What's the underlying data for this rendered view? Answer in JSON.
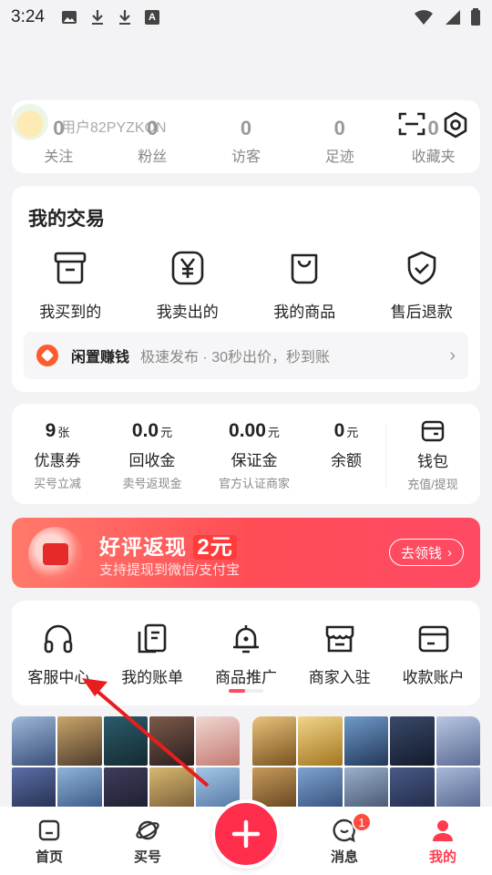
{
  "status_bar": {
    "time": "3:24",
    "a_icon": "A"
  },
  "profile": {
    "username": "用户82PYZKON",
    "stats": [
      {
        "value": "0",
        "label": "关注"
      },
      {
        "value": "0",
        "label": "粉丝"
      },
      {
        "value": "0",
        "label": "访客"
      },
      {
        "value": "0",
        "label": "足迹"
      },
      {
        "value": "0",
        "label": "收藏夹"
      }
    ]
  },
  "trade": {
    "title": "我的交易",
    "items": [
      {
        "label": "我买到的",
        "icon": "bought-box-icon"
      },
      {
        "label": "我卖出的",
        "icon": "yen-icon"
      },
      {
        "label": "我的商品",
        "icon": "bag-icon"
      },
      {
        "label": "售后退款",
        "icon": "shield-check-icon"
      }
    ],
    "idle": {
      "title": "闲置赚钱",
      "desc": "极速发布 · 30秒出价，秒到账"
    }
  },
  "wallet": {
    "items": [
      {
        "value": "9",
        "unit": "张",
        "name": "优惠券",
        "sub": "买号立减"
      },
      {
        "value": "0.0",
        "unit": "元",
        "name": "回收金",
        "sub": "卖号返现金"
      },
      {
        "value": "0.00",
        "unit": "元",
        "name": "保证金",
        "sub": "官方认证商家"
      },
      {
        "value": "0",
        "unit": "元",
        "name": "余额",
        "sub": ""
      }
    ],
    "purse": {
      "name": "钱包",
      "sub": "充值/提现"
    }
  },
  "banner": {
    "title_pre": "好评返现",
    "title_amount": "2元",
    "subtitle": "支持提现到微信/支付宝",
    "cta": "去领钱"
  },
  "services": [
    {
      "label": "客服中心",
      "icon": "headset-icon"
    },
    {
      "label": "我的账单",
      "icon": "bill-icon"
    },
    {
      "label": "商品推广",
      "icon": "bell-icon"
    },
    {
      "label": "商家入驻",
      "icon": "store-icon"
    },
    {
      "label": "收款账户",
      "icon": "wallet-card-icon"
    }
  ],
  "tabbar": {
    "items": [
      {
        "label": "首页"
      },
      {
        "label": "买号"
      },
      {
        "label": ""
      },
      {
        "label": "消息",
        "badge": "1"
      },
      {
        "label": "我的"
      }
    ]
  },
  "colors": {
    "accent": "#ff2e4d",
    "banner": "#ff4d56"
  }
}
